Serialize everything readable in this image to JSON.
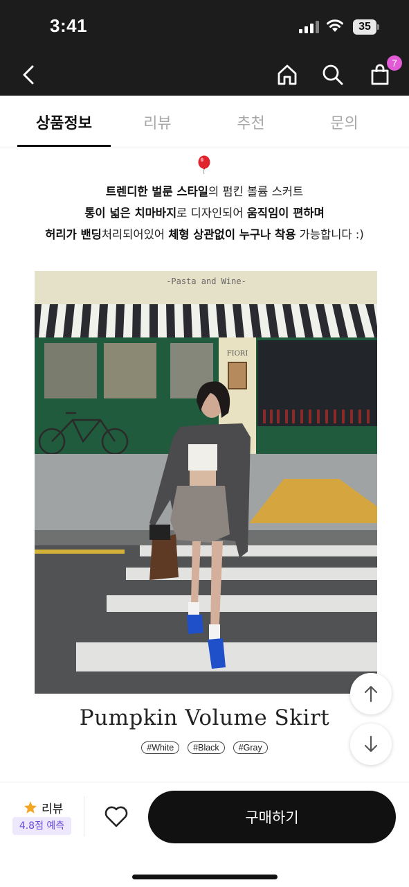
{
  "status_bar": {
    "time": "3:41",
    "battery": "35"
  },
  "nav": {
    "cart_count": "7"
  },
  "tabs": [
    {
      "label": "상품정보",
      "active": true
    },
    {
      "label": "리뷰",
      "active": false
    },
    {
      "label": "추천",
      "active": false
    },
    {
      "label": "문의",
      "active": false
    }
  ],
  "description": {
    "line1": {
      "b1": "트렌디한 벌룬 스타일",
      "t1": "의 펌킨 볼륨 스커트"
    },
    "line2": {
      "b1": "통이 넓은 치마바지",
      "t1": "로 디자인되어 ",
      "b2": "움직임이 편하며"
    },
    "line3": {
      "b1": "허리가 밴딩",
      "t1": "처리되어있어 ",
      "b2": "체형 상관없이 누구나 착용",
      "t2": " 가능합니다 :)"
    }
  },
  "product_image": {
    "sign_text": "-Pasta and Wine-",
    "shop_name": "FIORI"
  },
  "product": {
    "title": "Pumpkin Volume Skirt",
    "tags": [
      "#White",
      "#Black",
      "#Gray"
    ]
  },
  "bottom_bar": {
    "review_label": "리뷰",
    "review_score": "4.8점 예측",
    "buy_label": "구매하기"
  },
  "colors": {
    "accent_purple": "#6a4bd9",
    "badge_pink": "#e35ad6",
    "dark": "#1c1c1c"
  }
}
